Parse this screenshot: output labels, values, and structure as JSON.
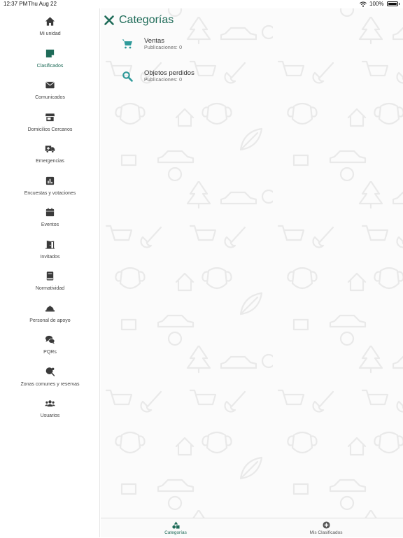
{
  "status_bar": {
    "time": "12:37 PM",
    "date": "Thu Aug 22",
    "battery": "100%"
  },
  "sidebar": {
    "items": [
      {
        "label": "Mi unidad",
        "icon": "home-icon",
        "active": false
      },
      {
        "label": "Clasificados",
        "icon": "sticky-note-icon",
        "active": true
      },
      {
        "label": "Comunicados",
        "icon": "envelope-icon",
        "active": false
      },
      {
        "label": "Domicilios Cercanos",
        "icon": "store-icon",
        "active": false
      },
      {
        "label": "Emergencias",
        "icon": "ambulance-icon",
        "active": false
      },
      {
        "label": "Encuestas y votaciones",
        "icon": "poll-icon",
        "active": false
      },
      {
        "label": "Eventos",
        "icon": "calendar-icon",
        "active": false
      },
      {
        "label": "Invitados",
        "icon": "door-icon",
        "active": false
      },
      {
        "label": "Normatividad",
        "icon": "book-icon",
        "active": false
      },
      {
        "label": "Personal de apoyo",
        "icon": "hard-hat-icon",
        "active": false
      },
      {
        "label": "PQRs",
        "icon": "comments-icon",
        "active": false
      },
      {
        "label": "Zonas comunes y reservas",
        "icon": "ping-pong-icon",
        "active": false
      },
      {
        "label": "Usuarios",
        "icon": "users-icon",
        "active": false
      }
    ]
  },
  "header": {
    "title": "Categorías"
  },
  "categories": [
    {
      "name": "Ventas",
      "count": "Publicaciones: 0",
      "icon": "shopping-cart-icon"
    },
    {
      "name": "Objetos perdidos",
      "count": "Publicaciones: 0",
      "icon": "search-icon"
    }
  ],
  "bottom_tabs": [
    {
      "label": "Categorías",
      "icon": "shapes-icon",
      "active": true
    },
    {
      "label": "Mis Clasificados",
      "icon": "plus-circle-icon",
      "active": false
    }
  ],
  "colors": {
    "accent": "#1e6b58",
    "icon_dark": "#3a3a3a",
    "category_icon": "#2f9a9a",
    "background": "#fbfbfb"
  }
}
